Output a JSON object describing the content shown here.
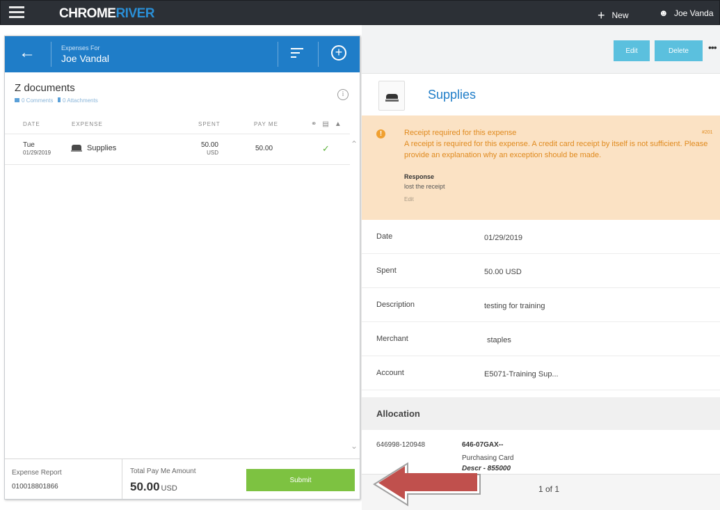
{
  "topbar": {
    "logo_part1": "CHROME",
    "logo_part2": "RIVER",
    "new_label": "New",
    "user_name": "Joe Vanda"
  },
  "report": {
    "expenses_for_label": "Expenses For",
    "owner": "Joe Vandal",
    "name": "Z documents",
    "comments": "0 Comments",
    "attachments": "0 Attachments",
    "columns": {
      "date": "DATE",
      "expense": "EXPENSE",
      "spent": "SPENT",
      "pay_me": "PAY ME"
    },
    "rows": [
      {
        "day": "Tue",
        "date": "01/29/2019",
        "expense": "Supplies",
        "spent": "50.00",
        "spent_currency": "USD",
        "pay_me": "50.00"
      }
    ]
  },
  "footer": {
    "report_label": "Expense Report",
    "report_number": "010018801866",
    "total_label": "Total Pay Me Amount",
    "total_amount": "50.00",
    "total_currency": "USD",
    "submit_label": "Submit"
  },
  "detail": {
    "edit_label": "Edit",
    "delete_label": "Delete",
    "category": "Supplies",
    "warning": {
      "title": "Receipt required for this expense",
      "code": "#201",
      "text": "A receipt is required for this expense. A credit card receipt by itself is not sufficient. Please provide an explanation why an exception should be made.",
      "response_label": "Response",
      "response_value": "lost the receipt",
      "edit_label": "Edit"
    },
    "fields": [
      {
        "label": "Date",
        "value": "01/29/2019"
      },
      {
        "label": "Spent",
        "value": "50.00 USD"
      },
      {
        "label": "Description",
        "value": "testing for training"
      },
      {
        "label": "Merchant",
        "value": "staples"
      },
      {
        "label": "Account",
        "value": "E5071-Training Sup..."
      }
    ],
    "allocation": {
      "title": "Allocation",
      "code": "646998-120948",
      "name": "646-07GAX--",
      "type": "Purchasing Card",
      "desc": "Descr - 855000"
    },
    "pager": "1 of 1"
  },
  "colors": {
    "topbar": "#2c3036",
    "brand_blue": "#1f7dc8",
    "submit_green": "#7dc241",
    "action_cyan": "#5bc0de",
    "warning_bg": "#fbe2c4",
    "warning_text": "#e08a1e",
    "annotation_arrow": "#c0504d"
  },
  "icons": [
    "menu-icon",
    "plus-icon",
    "user-icon",
    "back-arrow-icon",
    "sort-icon",
    "add-circle-icon",
    "info-icon",
    "comment-icon",
    "attachment-icon",
    "stapler-icon",
    "check-icon",
    "warning-icon",
    "more-icon"
  ]
}
